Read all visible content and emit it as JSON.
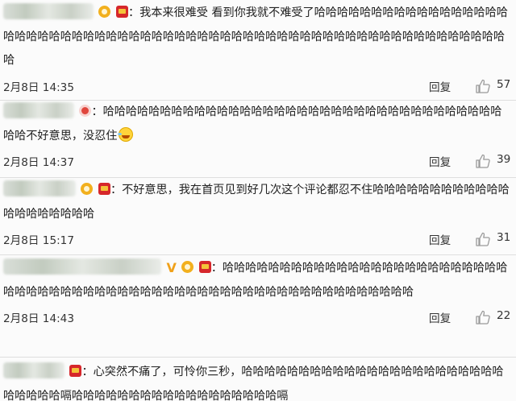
{
  "comments": [
    {
      "text": "我本来很难受 看到你我就不难受了哈哈哈哈哈哈哈哈哈哈哈哈哈哈哈哈哈哈哈哈哈哈哈哈哈哈哈哈哈哈哈哈哈哈哈哈哈哈哈哈哈哈哈哈哈哈哈哈哈哈哈哈哈哈哈哈哈哈哈哈哈哈",
      "time": "2月8日 14:35",
      "reply_label": "回复",
      "likes": "57"
    },
    {
      "text": "哈哈哈哈哈哈哈哈哈哈哈哈哈哈哈哈哈哈哈哈哈哈哈哈哈哈哈哈哈哈哈哈哈哈哈哈哈不好意思，没忍住",
      "time": "2月8日 14:37",
      "reply_label": "回复",
      "likes": "39"
    },
    {
      "text": "不好意思，我在首页见到好几次这个评论都忍不住哈哈哈哈哈哈哈哈哈哈哈哈哈哈哈哈哈哈哈哈",
      "time": "2月8日 15:17",
      "reply_label": "回复",
      "likes": "31"
    },
    {
      "text": "哈哈哈哈哈哈哈哈哈哈哈哈哈哈哈哈哈哈哈哈哈哈哈哈哈哈哈哈哈哈哈哈哈哈哈哈哈哈哈哈哈哈哈哈哈哈哈哈哈哈哈哈哈哈哈哈哈哈哈哈哈",
      "time": "2月8日 14:43",
      "reply_label": "回复",
      "likes": "22"
    },
    {
      "text": "心突然不痛了，可怜你三秒，哈哈哈哈哈哈哈哈哈哈哈哈哈哈哈哈哈哈哈哈哈哈哈哈哈哈哈哈嗝哈哈哈哈哈哈哈哈哈哈哈哈哈哈哈哈哈哈嗝"
    }
  ],
  "colors": {
    "background": "#fbfbfb",
    "divider": "#dedede",
    "icon": "#9a9a9a"
  },
  "icons": {
    "like": "thumbs-up-icon",
    "badge": "red-packet-badge-icon"
  }
}
